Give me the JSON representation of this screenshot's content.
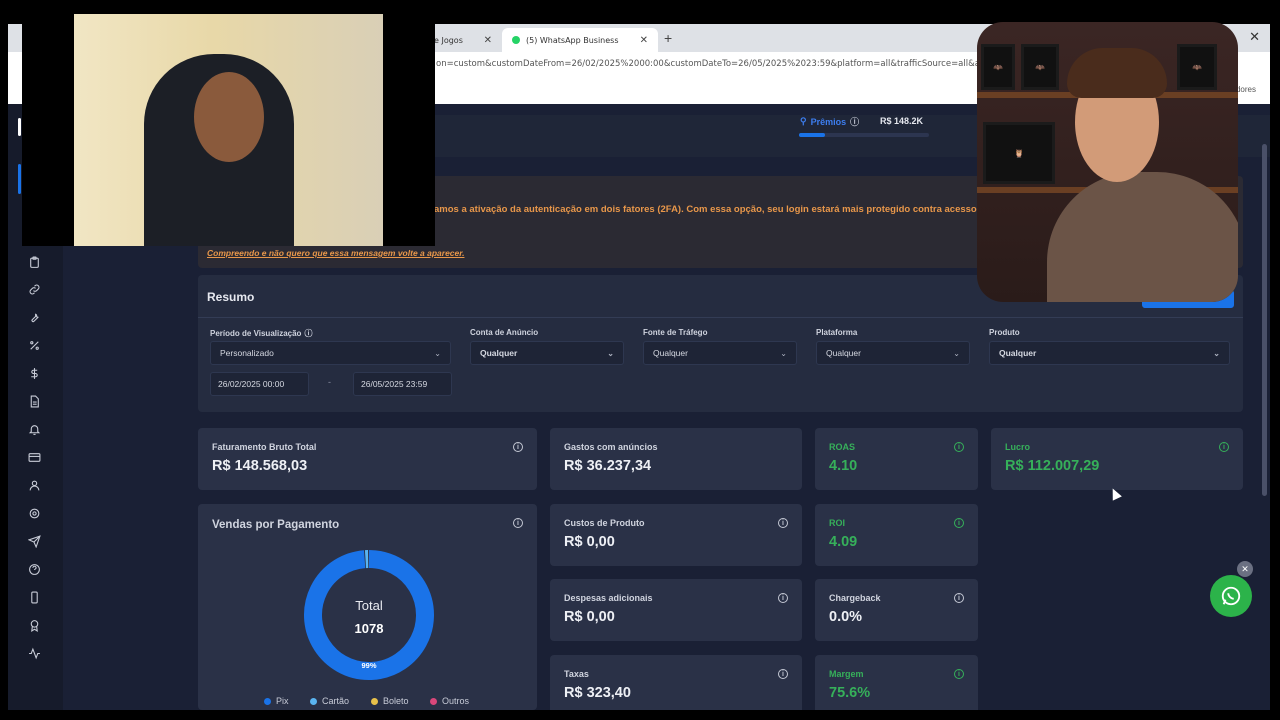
{
  "browser": {
    "tabs": [
      {
        "label": "e Jogos"
      },
      {
        "label": "(5) WhatsApp Business"
      }
    ],
    "url": "on=custom&customDateFrom=26/02/2025%2000:00&customDateTo=26/05/2025%2023:59&platform=all&trafficSource=all&adAcco",
    "bookmarks_label": "adores"
  },
  "header": {
    "premios_label": "Prêmios",
    "premios_value": "R$ 148.2K",
    "premios_progress": 0.2
  },
  "alert": {
    "text": "amos a ativação da autenticação em dois fatores (2FA). Com essa opção, seu login estará mais protegido contra acessos nã",
    "link": "Compreendo e não quero que essa mensagem volte a aparecer."
  },
  "resumo": {
    "title": "Resumo",
    "filters": {
      "periodo_label": "Período de Visualização",
      "periodo_value": "Personalizado",
      "conta_label": "Conta de Anúncio",
      "conta_value": "Qualquer",
      "fonte_label": "Fonte de Tráfego",
      "fonte_value": "Qualquer",
      "plataforma_label": "Plataforma",
      "plataforma_value": "Qualquer",
      "produto_label": "Produto",
      "produto_value": "Qualquer",
      "date_from": "26/02/2025 00:00",
      "date_sep": "-",
      "date_to": "26/05/2025 23:59"
    }
  },
  "metrics": {
    "faturamento": {
      "label": "Faturamento Bruto Total",
      "value": "R$ 148.568,03"
    },
    "gastos": {
      "label": "Gastos com anúncios",
      "value": "R$ 36.237,34"
    },
    "roas": {
      "label": "ROAS",
      "value": "4.10"
    },
    "lucro": {
      "label": "Lucro",
      "value": "R$ 112.007,29"
    },
    "custos": {
      "label": "Custos de Produto",
      "value": "R$ 0,00"
    },
    "roi": {
      "label": "ROI",
      "value": "4.09"
    },
    "despesas": {
      "label": "Despesas adicionais",
      "value": "R$ 0,00"
    },
    "chargeback": {
      "label": "Chargeback",
      "value": "0.0%"
    },
    "taxas": {
      "label": "Taxas",
      "value": "R$ 323,40"
    },
    "margem": {
      "label": "Margem",
      "value": "75.6%"
    }
  },
  "vendas": {
    "title": "Vendas por Pagamento",
    "total_label": "Total",
    "total_value": "1078",
    "pct_label": "99%"
  },
  "chart_data": {
    "type": "pie",
    "title": "Vendas por Pagamento",
    "categories": [
      "Pix",
      "Cartão",
      "Boleto",
      "Outros"
    ],
    "values": [
      99,
      1,
      0,
      0
    ],
    "colors": [
      "#1a73e8",
      "#5ab4f0",
      "#e8c14a",
      "#d9477a"
    ],
    "total": 1078
  },
  "colors": {
    "accent": "#1a73e8",
    "positive": "#36b05a",
    "warning": "#e8974a",
    "whatsapp": "#2cb34a"
  },
  "icons": [
    "clipboard-icon",
    "link-icon",
    "wrench-icon",
    "percent-icon",
    "dollar-icon",
    "document-icon",
    "bell-icon",
    "card-icon",
    "user-icon",
    "gear-icon",
    "send-icon",
    "help-icon",
    "phone-icon",
    "award-icon",
    "activity-icon"
  ]
}
